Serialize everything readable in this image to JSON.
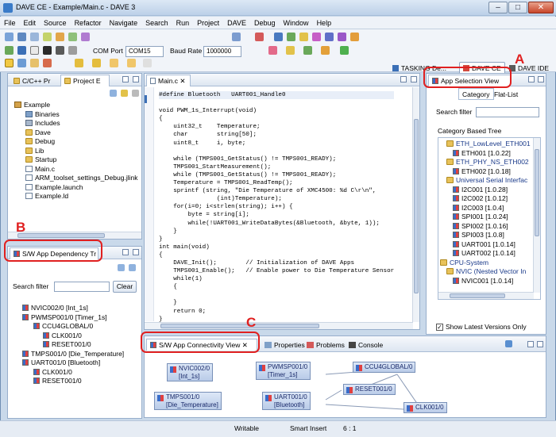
{
  "window": {
    "title": "DAVE CE - Example/Main.c - DAVE 3",
    "minimize": "–",
    "maximize": "□",
    "close": "✕"
  },
  "menu": [
    "File",
    "Edit",
    "Source",
    "Refactor",
    "Navigate",
    "Search",
    "Run",
    "Project",
    "DAVE",
    "Debug",
    "Window",
    "Help"
  ],
  "toolbar": {
    "com_port_label": "COM Port",
    "com_port_value": "COM15",
    "baud_label": "Baud Rate",
    "baud_value": "1000000"
  },
  "perspectives": [
    {
      "label": "TASKING De..."
    },
    {
      "label": "DAVE CE"
    },
    {
      "label": "DAVE IDE"
    }
  ],
  "project_panel": {
    "tabs": [
      "C/C++ Pr",
      "Project E"
    ],
    "tree": [
      {
        "label": "Example",
        "icon": "project-icon",
        "depth": 0
      },
      {
        "label": "Binaries",
        "icon": "binaries-icon",
        "depth": 1
      },
      {
        "label": "Includes",
        "icon": "includes-icon",
        "depth": 1
      },
      {
        "label": "Dave",
        "icon": "folder-icon",
        "depth": 1
      },
      {
        "label": "Debug",
        "icon": "folder-icon",
        "depth": 1
      },
      {
        "label": "Lib",
        "icon": "folder-icon",
        "depth": 1
      },
      {
        "label": "Startup",
        "icon": "folder-icon",
        "depth": 1
      },
      {
        "label": "Main.c",
        "icon": "c-file-icon",
        "depth": 1
      },
      {
        "label": "ARM_toolset_settings_Debug.jlink",
        "icon": "file-icon",
        "depth": 1
      },
      {
        "label": "Example.launch",
        "icon": "file-icon",
        "depth": 1
      },
      {
        "label": "Example.ld",
        "icon": "file-icon",
        "depth": 1
      }
    ]
  },
  "dependency_panel": {
    "tab": "S/W App Dependency Tr",
    "filter_label": "Search filter",
    "clear_label": "Clear",
    "tree": [
      {
        "label": "NVIC002/0 [Int_1s]",
        "depth": 0
      },
      {
        "label": "PWMSP001/0 [Timer_1s]",
        "depth": 0
      },
      {
        "label": "CCU4GLOBAL/0",
        "depth": 1
      },
      {
        "label": "CLK001/0",
        "depth": 2
      },
      {
        "label": "RESET001/0",
        "depth": 2
      },
      {
        "label": "TMPS001/0 [Die_Temperature]",
        "depth": 0
      },
      {
        "label": "UART001/0 [Bluetooth]",
        "depth": 0
      },
      {
        "label": "CLK001/0",
        "depth": 1
      },
      {
        "label": "RESET001/0",
        "depth": 1
      }
    ]
  },
  "editor": {
    "tab": "Main.c",
    "lines": [
      "#define Bluetooth   UART001_Handle0",
      "",
      "void PWM_1s_Interrupt(void)",
      "{",
      "    uint32_t    Temperature;",
      "    char        string[50];",
      "    uint8_t     i, byte;",
      "",
      "    while (TMPS001_GetStatus() != TMPS001_READY);",
      "    TMPS001_StartMeasurement();",
      "    while (TMPS001_GetStatus() != TMPS001_READY);",
      "    Temperature = TMPS001_ReadTemp();",
      "    sprintf (string, \"Die Temperature of XMC4500: %d C\\r\\n\",",
      "                (int)Temperature);",
      "    for(i=0; i<strlen(string); i++) {",
      "        byte = string[i];",
      "        while(!UART001_WriteDataBytes(&Bluetooth, &byte, 1));",
      "    }",
      "}",
      "int main(void)",
      "{",
      "    DAVE_Init();        // Initialization of DAVE Apps",
      "    TMPS001_Enable();   // Enable power to Die Temperature Sensor",
      "    while(1)",
      "    {",
      "",
      "    }",
      "    return 0;",
      "}"
    ]
  },
  "app_selection_panel": {
    "tab": "App Selection View",
    "subtabs": [
      "Category",
      "Flat-List"
    ],
    "filter_label": "Search filter",
    "tree_title": "Category Based Tree",
    "tree": [
      {
        "label": "ETH_LowLevel_ETH001",
        "kind": "category",
        "depth": 1
      },
      {
        "label": "ETH001 [1.0.22]",
        "kind": "app",
        "depth": 2
      },
      {
        "label": "ETH_PHY_NS_ETH002",
        "kind": "category",
        "depth": 1
      },
      {
        "label": "ETH002 [1.0.18]",
        "kind": "app",
        "depth": 2
      },
      {
        "label": "Universal Serial Interfac",
        "kind": "category",
        "depth": 1
      },
      {
        "label": "I2C001 [1.0.28]",
        "kind": "app",
        "depth": 2
      },
      {
        "label": "I2C002 [1.0.12]",
        "kind": "app",
        "depth": 2
      },
      {
        "label": "I2C003 [1.0.4]",
        "kind": "app",
        "depth": 2
      },
      {
        "label": "SPI001 [1.0.24]",
        "kind": "app",
        "depth": 2
      },
      {
        "label": "SPI002 [1.0.16]",
        "kind": "app",
        "depth": 2
      },
      {
        "label": "SPI003 [1.0.8]",
        "kind": "app",
        "depth": 2
      },
      {
        "label": "UART001 [1.0.14]",
        "kind": "app",
        "depth": 2
      },
      {
        "label": "UART002 [1.0.14]",
        "kind": "app",
        "depth": 2
      },
      {
        "label": "CPU-System",
        "kind": "category",
        "depth": 0
      },
      {
        "label": "NVIC (Nested Vector In",
        "kind": "category",
        "depth": 1
      },
      {
        "label": "NVIC001 [1.0.14]",
        "kind": "app",
        "depth": 2
      }
    ],
    "show_latest_label": "Show Latest Versions Only"
  },
  "connectivity_panel": {
    "tabs": [
      "S/W App Connectivity View",
      "Properties",
      "Problems",
      "Console"
    ],
    "nodes": [
      {
        "id": "nvic",
        "line1": "NVIC002/0",
        "line2": "[Int_1s]"
      },
      {
        "id": "pwm",
        "line1": "PWMSP001/0",
        "line2": "[Timer_1s]"
      },
      {
        "id": "ccu4",
        "line1": "CCU4GLOBAL/0",
        "line2": ""
      },
      {
        "id": "reset",
        "line1": "RESET001/0",
        "line2": ""
      },
      {
        "id": "tmps",
        "line1": "TMPS001/0",
        "line2": "[Die_Temperature]"
      },
      {
        "id": "uart",
        "line1": "UART001/0",
        "line2": "[Bluetooth]"
      },
      {
        "id": "clk",
        "line1": "CLK001/0",
        "line2": ""
      }
    ]
  },
  "status": {
    "mode": "Writable",
    "insert": "Smart Insert",
    "position": "6 : 1"
  },
  "annotations": {
    "a": "A",
    "b": "B",
    "c": "C"
  }
}
